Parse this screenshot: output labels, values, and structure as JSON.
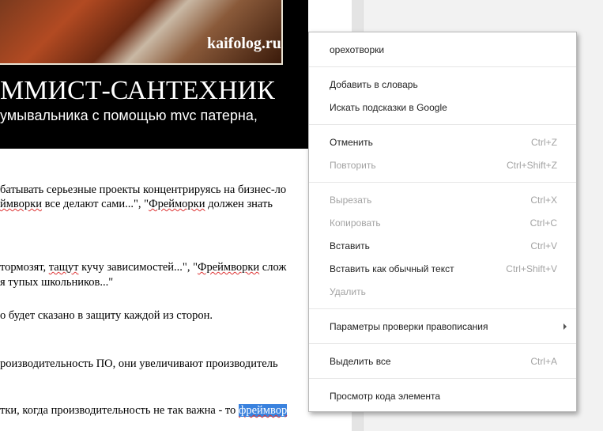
{
  "page": {
    "banner": {
      "watermark": "kaifolog.ru",
      "title": "ММИСТ-САНТЕХНИК",
      "subtitle": "умывальника с помощью mvc патерна,"
    },
    "text": {
      "l1": "батывать серьезные проекты концентрируясь на бизнес-ло",
      "l2a": "ймворки",
      "l2b": " все делают сами...\", \"",
      "l2c": "Фрейморки",
      "l2d": " должен знать",
      "l3a": "тормозят, ",
      "l3b": "тащут",
      "l3c": " кучу зависимостей...\", \"",
      "l3d": "Фреймворки",
      "l3e": " слож",
      "l4": "я тупых школьников...\"",
      "l5": "о будет сказано в защиту каждой из сторон.",
      "l6": "роизводительность ПО, они увеличивают производитель",
      "l7a": "тки, когда производительность не так важна - то ",
      "l7b": "фреймвор"
    }
  },
  "context_menu": {
    "suggestion": "орехотворки",
    "add_to_dictionary": "Добавить в словарь",
    "search_google": "Искать подсказки в Google",
    "undo": {
      "label": "Отменить",
      "shortcut": "Ctrl+Z"
    },
    "redo": {
      "label": "Повторить",
      "shortcut": "Ctrl+Shift+Z"
    },
    "cut": {
      "label": "Вырезать",
      "shortcut": "Ctrl+X"
    },
    "copy": {
      "label": "Копировать",
      "shortcut": "Ctrl+C"
    },
    "paste": {
      "label": "Вставить",
      "shortcut": "Ctrl+V"
    },
    "paste_plain": {
      "label": "Вставить как обычный текст",
      "shortcut": "Ctrl+Shift+V"
    },
    "delete": {
      "label": "Удалить"
    },
    "spellcheck_options": {
      "label": "Параметры проверки правописания"
    },
    "select_all": {
      "label": "Выделить все",
      "shortcut": "Ctrl+A"
    },
    "inspect": {
      "label": "Просмотр кода элемента"
    }
  },
  "colors": {
    "selection": "#3a82de",
    "disabled_text": "#a3a3a3",
    "spell_underline": "#d33"
  }
}
